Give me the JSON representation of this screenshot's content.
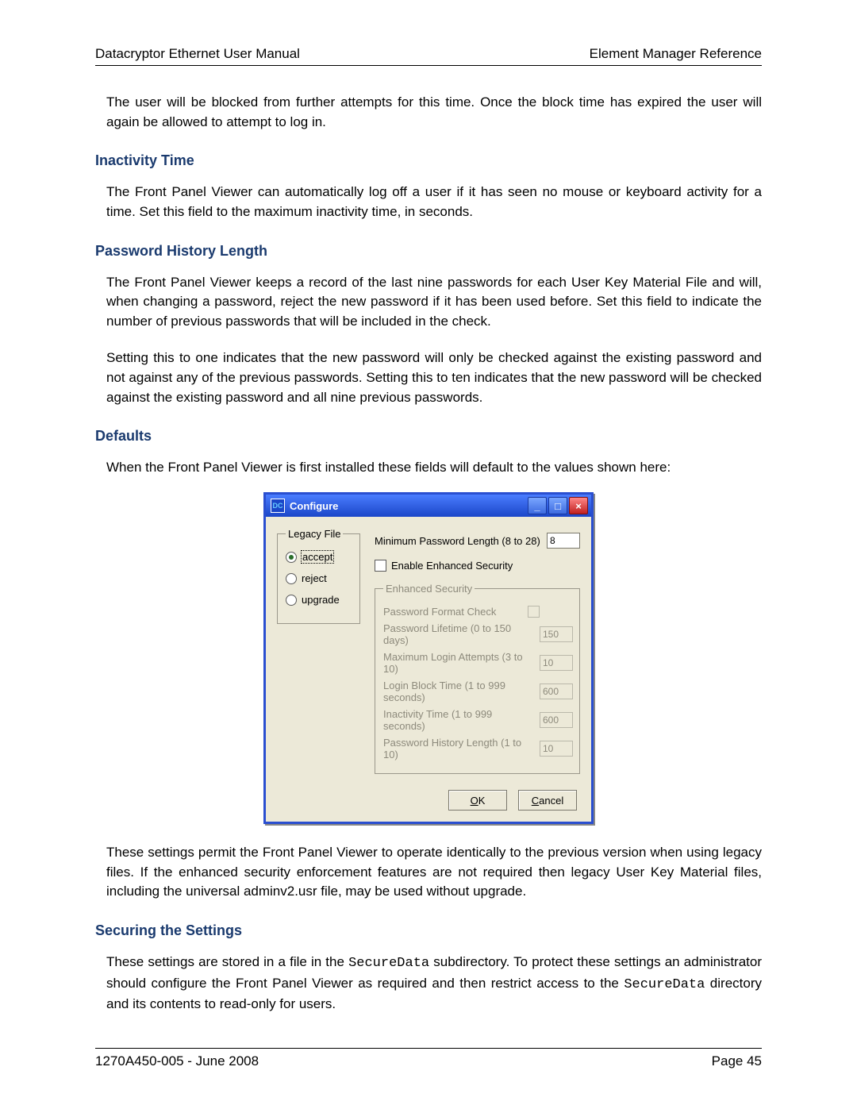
{
  "header": {
    "left": "Datacryptor Ethernet User Manual",
    "right": "Element Manager Reference"
  },
  "intro_para": "The user will be blocked from further attempts for this time.  Once the block time has expired the user will again be allowed to attempt to log in.",
  "sections": {
    "inactivity": {
      "title": "Inactivity Time",
      "body": "The Front Panel Viewer can automatically log off a user if it has seen no mouse or keyboard activity for a time.  Set this field to the maximum inactivity time, in seconds."
    },
    "pwd_hist": {
      "title": "Password History Length",
      "body1": "The Front Panel Viewer keeps a record of the last nine passwords for each User Key Material File and will, when changing a password, reject the new password if it has been used before.  Set this field to indicate the number of previous passwords that will be included in the check.",
      "body2": "Setting this to one indicates that the new password will only be checked against the existing password and not against any of the previous passwords.  Setting this to ten indicates that the new password will be checked against the existing password and all nine previous passwords."
    },
    "defaults": {
      "title": "Defaults",
      "body_before": "When the Front Panel Viewer is first installed these fields will default to the values shown here:",
      "body_after_1": "These settings permit the Front Panel Viewer to operate identically to the previous version when using legacy files.  If the enhanced security enforcement features are not required then legacy User Key Material files, including the universal adminv2.usr file, may be used without upgrade."
    },
    "securing": {
      "title": "Securing the Settings",
      "body_pre": "These settings are stored in a file in the ",
      "body_mid1": "SecureData",
      "body_mid2": " subdirectory.  To protect these settings an administrator should configure the Front Panel Viewer as required and then restrict access to the ",
      "body_mid3": "SecureData",
      "body_post": " directory and its contents to read-only for users."
    }
  },
  "dialog": {
    "title": "Configure",
    "legacy": {
      "legend": "Legacy File",
      "opt_accept": "accept",
      "opt_reject": "reject",
      "opt_upgrade": "upgrade",
      "selected": "accept"
    },
    "min_pwd_label": "Minimum Password Length (8 to 28)",
    "min_pwd_value": "8",
    "enable_enh_label": "Enable Enhanced Security",
    "enh_legend": "Enhanced Security",
    "rows": {
      "fmt": {
        "label": "Password Format Check",
        "value": ""
      },
      "life": {
        "label": "Password Lifetime (0 to 150 days)",
        "value": "150"
      },
      "maxlog": {
        "label": "Maximum Login Attempts (3 to 10)",
        "value": "10"
      },
      "block": {
        "label": "Login Block Time (1 to 999 seconds)",
        "value": "600"
      },
      "inact": {
        "label": "Inactivity Time (1 to 999 seconds)",
        "value": "600"
      },
      "hist": {
        "label": "Password History Length (1 to 10)",
        "value": "10"
      }
    },
    "ok_label": "OK",
    "cancel_label": "Cancel"
  },
  "footer": {
    "left": "1270A450-005 -  June 2008",
    "right": "Page 45"
  }
}
